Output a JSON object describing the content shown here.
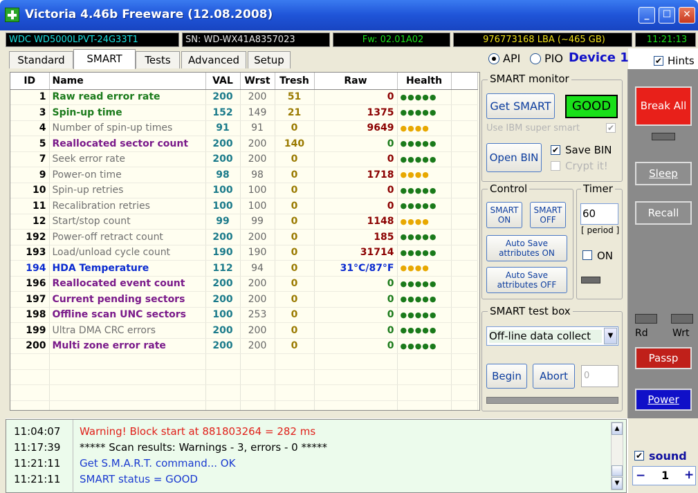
{
  "window": {
    "title": "Victoria 4.46b Freeware (12.08.2008)"
  },
  "info_bar": {
    "model": "WDC WD5000LPVT-24G33T1",
    "serial": "SN: WD-WX41A8357023",
    "firmware": "Fw: 02.01A02",
    "capacity": "976773168 LBA (~465 GB)",
    "time": "11:21:13"
  },
  "tabs": [
    "Standard",
    "SMART",
    "Tests",
    "Advanced",
    "Setup"
  ],
  "active_tab": "SMART",
  "mode": {
    "api_label": "API",
    "pio_label": "PIO",
    "selected": "API",
    "device_label": "Device 1"
  },
  "hints": {
    "label": "Hints",
    "checked": true
  },
  "smart_table": {
    "columns": [
      "ID",
      "Name",
      "VAL",
      "Wrst",
      "Tresh",
      "Raw",
      "Health"
    ],
    "rows": [
      {
        "id": "1",
        "name": "Raw read error rate",
        "val": "200",
        "wrst": "200",
        "tresh": "51",
        "raw": "0",
        "health": "●●●●●",
        "name_color": "#1a7a1a",
        "raw_color": "#8b0000",
        "health_color": "#1a7a1a"
      },
      {
        "id": "3",
        "name": "Spin-up time",
        "val": "152",
        "wrst": "149",
        "tresh": "21",
        "raw": "1375",
        "health": "●●●●●",
        "name_color": "#1a7a1a",
        "raw_color": "#8b0000",
        "health_color": "#1a7a1a"
      },
      {
        "id": "4",
        "name": "Number of spin-up times",
        "val": "91",
        "wrst": "91",
        "tresh": "0",
        "raw": "9649",
        "health": "●●●●",
        "name_color": "#707070",
        "raw_color": "#8b0000",
        "health_color": "#e8a800"
      },
      {
        "id": "5",
        "name": "Reallocated sector count",
        "val": "200",
        "wrst": "200",
        "tresh": "140",
        "raw": "0",
        "health": "●●●●●",
        "name_color": "#7a1a8a",
        "raw_color": "#1a7a1a",
        "health_color": "#1a7a1a"
      },
      {
        "id": "7",
        "name": "Seek error rate",
        "val": "200",
        "wrst": "200",
        "tresh": "0",
        "raw": "0",
        "health": "●●●●●",
        "name_color": "#707070",
        "raw_color": "#8b0000",
        "health_color": "#1a7a1a"
      },
      {
        "id": "9",
        "name": "Power-on time",
        "val": "98",
        "wrst": "98",
        "tresh": "0",
        "raw": "1718",
        "health": "●●●●",
        "name_color": "#707070",
        "raw_color": "#8b0000",
        "health_color": "#e8a800"
      },
      {
        "id": "10",
        "name": "Spin-up retries",
        "val": "100",
        "wrst": "100",
        "tresh": "0",
        "raw": "0",
        "health": "●●●●●",
        "name_color": "#707070",
        "raw_color": "#8b0000",
        "health_color": "#1a7a1a"
      },
      {
        "id": "11",
        "name": "Recalibration retries",
        "val": "100",
        "wrst": "100",
        "tresh": "0",
        "raw": "0",
        "health": "●●●●●",
        "name_color": "#707070",
        "raw_color": "#8b0000",
        "health_color": "#1a7a1a"
      },
      {
        "id": "12",
        "name": "Start/stop count",
        "val": "99",
        "wrst": "99",
        "tresh": "0",
        "raw": "1148",
        "health": "●●●●",
        "name_color": "#707070",
        "raw_color": "#8b0000",
        "health_color": "#e8a800"
      },
      {
        "id": "192",
        "name": "Power-off retract count",
        "val": "200",
        "wrst": "200",
        "tresh": "0",
        "raw": "185",
        "health": "●●●●●",
        "name_color": "#707070",
        "raw_color": "#8b0000",
        "health_color": "#1a7a1a"
      },
      {
        "id": "193",
        "name": "Load/unload cycle count",
        "val": "190",
        "wrst": "190",
        "tresh": "0",
        "raw": "31714",
        "health": "●●●●●",
        "name_color": "#707070",
        "raw_color": "#8b0000",
        "health_color": "#1a7a1a"
      },
      {
        "id": "194",
        "name": "HDA Temperature",
        "val": "112",
        "wrst": "94",
        "tresh": "0",
        "raw": "31°C/87°F",
        "health": "●●●●",
        "name_color": "#0a2ad0",
        "raw_color": "#0a2ad0",
        "health_color": "#e8a800"
      },
      {
        "id": "196",
        "name": "Reallocated event count",
        "val": "200",
        "wrst": "200",
        "tresh": "0",
        "raw": "0",
        "health": "●●●●●",
        "name_color": "#7a1a8a",
        "raw_color": "#1a7a1a",
        "health_color": "#1a7a1a"
      },
      {
        "id": "197",
        "name": "Current pending sectors",
        "val": "200",
        "wrst": "200",
        "tresh": "0",
        "raw": "0",
        "health": "●●●●●",
        "name_color": "#7a1a8a",
        "raw_color": "#1a7a1a",
        "health_color": "#1a7a1a"
      },
      {
        "id": "198",
        "name": "Offline scan UNC sectors",
        "val": "100",
        "wrst": "253",
        "tresh": "0",
        "raw": "0",
        "health": "●●●●●",
        "name_color": "#7a1a8a",
        "raw_color": "#1a7a1a",
        "health_color": "#1a7a1a"
      },
      {
        "id": "199",
        "name": "Ultra DMA CRC errors",
        "val": "200",
        "wrst": "200",
        "tresh": "0",
        "raw": "0",
        "health": "●●●●●",
        "name_color": "#707070",
        "raw_color": "#1a7a1a",
        "health_color": "#1a7a1a"
      },
      {
        "id": "200",
        "name": "Multi zone error rate",
        "val": "200",
        "wrst": "200",
        "tresh": "0",
        "raw": "0",
        "health": "●●●●●",
        "name_color": "#7a1a8a",
        "raw_color": "#1a7a1a",
        "health_color": "#1a7a1a"
      }
    ]
  },
  "smart_monitor": {
    "label": "SMART monitor",
    "get_smart": "Get SMART",
    "status": "GOOD",
    "ibm_label": "Use IBM super smart",
    "ibm_checked": true,
    "open_bin": "Open BIN",
    "save_bin_label": "Save BIN",
    "save_bin_checked": true,
    "crypt_label": "Crypt it!",
    "crypt_checked": false
  },
  "control": {
    "label": "Control",
    "smart_on": "SMART ON",
    "smart_off": "SMART OFF",
    "autosave_on": "Auto Save attributes ON",
    "autosave_off": "Auto Save attributes OFF"
  },
  "timer": {
    "label": "Timer",
    "value": "60",
    "period_label": "[ period ]",
    "on_label": "ON",
    "on_checked": false
  },
  "test_box": {
    "label": "SMART test box",
    "selected": "Off-line data collect",
    "begin": "Begin",
    "abort": "Abort",
    "value": "0"
  },
  "side_buttons": {
    "break_all": "Break All",
    "sleep": "Sleep",
    "recall": "Recall",
    "rd": "Rd",
    "wrt": "Wrt",
    "passp": "Passp",
    "power": "Power"
  },
  "sound": {
    "label": "sound",
    "checked": true,
    "value": "1",
    "minus": "−",
    "plus": "+"
  },
  "log": [
    {
      "time": "11:04:07",
      "message": "Warning! Block start at 881803264 = 282 ms",
      "color": "#e0201a"
    },
    {
      "time": "11:17:39",
      "message": "***** Scan results: Warnings - 3, errors - 0 *****",
      "color": "#000000"
    },
    {
      "time": "11:21:11",
      "message": "Get S.M.A.R.T. command... OK",
      "color": "#1a3ad0"
    },
    {
      "time": "11:21:11",
      "message": "SMART status = GOOD",
      "color": "#1a3ad0"
    }
  ],
  "colors": {
    "good_bg": "#19e019",
    "break_bg": "#e8201a",
    "passp_bg": "#c0201a",
    "power_bg": "#1010c8"
  }
}
